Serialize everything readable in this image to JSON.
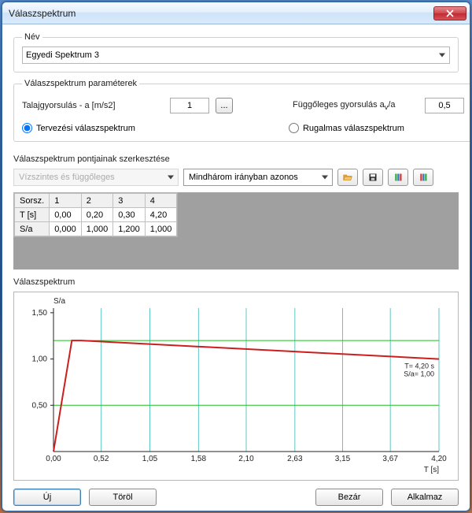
{
  "window_title": "Válaszspektrum",
  "name_group": {
    "legend": "Név",
    "selected": "Egyedi Spektrum 3"
  },
  "params": {
    "legend": "Válaszspektrum paraméterek",
    "accel_label": "Talajgyorsulás - a [m/s2]",
    "accel_value": "1",
    "ellipsis": "...",
    "vert_label_prefix": "Függőleges gyorsulás a",
    "vert_label_sub": "v",
    "vert_label_suffix": "/a",
    "vert_value": "0,5",
    "radio_design": "Tervezési válaszspektrum",
    "radio_elastic": "Rugalmas válaszspektrum"
  },
  "edit": {
    "heading": "Válaszspektrum pontjainak szerkesztése",
    "combo_disabled": "Vízszintes és függőleges",
    "combo_dir": "Mindhárom irányban azonos"
  },
  "table": {
    "row_hdrs": [
      "Sorsz.",
      "T [s]",
      "S/a"
    ],
    "cols": [
      "1",
      "2",
      "3",
      "4"
    ],
    "t": [
      "0,00",
      "0,20",
      "0,30",
      "4,20"
    ],
    "sa": [
      "0,000",
      "1,000",
      "1,200",
      "1,000"
    ]
  },
  "chart_section_heading": "Válaszspektrum",
  "chart_data": {
    "type": "line",
    "xlabel": "T [s]",
    "ylabel": "S/a",
    "xticks": [
      0.0,
      0.52,
      1.05,
      1.58,
      2.1,
      2.63,
      3.15,
      3.67,
      4.2
    ],
    "xtick_labels": [
      "0,00",
      "0,52",
      "1,05",
      "1,58",
      "2,10",
      "2,63",
      "3,15",
      "3,67",
      "4,20"
    ],
    "yticks": [
      0.5,
      1.0,
      1.5
    ],
    "ytick_labels": [
      "0,50",
      "1,00",
      "1,50"
    ],
    "xlim": [
      0.0,
      4.2
    ],
    "ylim": [
      0.0,
      1.55
    ],
    "series": [
      {
        "name": "spectrum",
        "color": "#cc1e1e",
        "x": [
          0.0,
          0.2,
          0.3,
          4.2
        ],
        "y": [
          0.0,
          1.2,
          1.2,
          1.0
        ]
      }
    ],
    "grid": {
      "vlines": 9,
      "hmajor": [
        0.5,
        1.0,
        1.5
      ],
      "hgreen": [
        0.5,
        1.2
      ]
    },
    "annotation": {
      "line1": "T= 4,20 s",
      "line2": "S/a= 1,00",
      "at_x": 4.2,
      "at_y": 1.0
    }
  },
  "footer": {
    "new": "Új",
    "delete": "Töröl",
    "close": "Bezár",
    "apply": "Alkalmaz"
  }
}
